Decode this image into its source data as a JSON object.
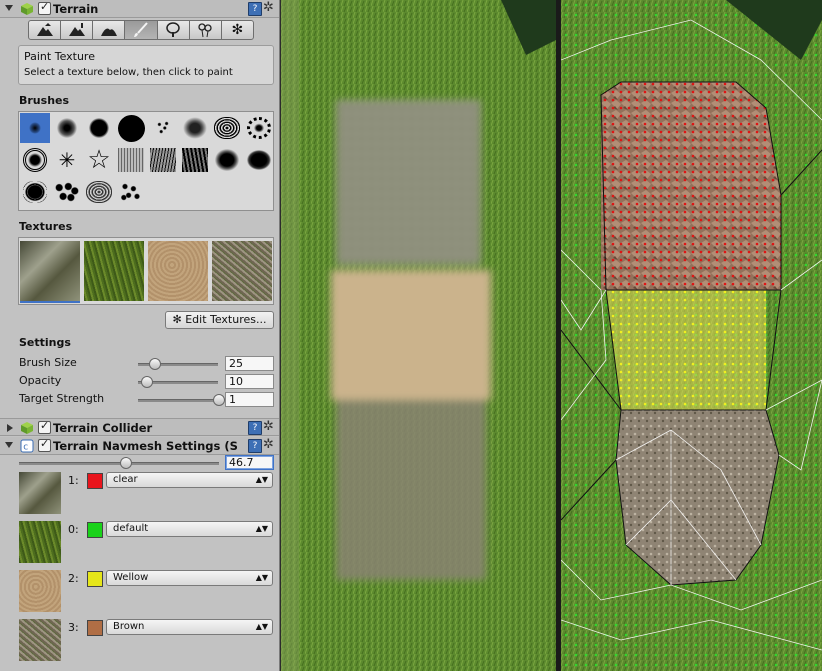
{
  "inspector": {
    "terrain": {
      "title": "Terrain",
      "enabled": true
    },
    "tools": [
      {
        "name": "raise-lower-terrain-tool",
        "icon": "mountain-up-icon"
      },
      {
        "name": "paint-height-tool",
        "icon": "mountain-height-icon"
      },
      {
        "name": "smooth-height-tool",
        "icon": "mountain-smooth-icon"
      },
      {
        "name": "paint-texture-tool",
        "icon": "paintbrush-icon",
        "active": true
      },
      {
        "name": "place-trees-tool",
        "icon": "tree-icon"
      },
      {
        "name": "paint-details-tool",
        "icon": "flowers-icon"
      },
      {
        "name": "terrain-settings-tool",
        "icon": "gear-icon"
      }
    ],
    "info": {
      "title": "Paint Texture",
      "hint": "Select a texture below, then click to paint"
    },
    "brushes_label": "Brushes",
    "textures_label": "Textures",
    "edit_textures_label": "Edit Textures...",
    "settings_label": "Settings",
    "settings": [
      {
        "label": "Brush Size",
        "value": "25",
        "fraction": 0.2
      },
      {
        "label": "Opacity",
        "value": "10",
        "fraction": 0.1
      },
      {
        "label": "Target Strength",
        "value": "1",
        "fraction": 1.0
      }
    ],
    "collider": {
      "title": "Terrain Collider",
      "enabled": true
    },
    "navmesh": {
      "title": "Terrain Navmesh Settings (S",
      "enabled": true,
      "slider_value": "46.7",
      "slider_fraction": 0.53,
      "rows": [
        {
          "index": "1:",
          "color": "#e8141c",
          "option": "clear",
          "texture": "rock"
        },
        {
          "index": "0:",
          "color": "#19d219",
          "option": "default",
          "texture": "grass"
        },
        {
          "index": "2:",
          "color": "#e6e619",
          "option": "Wellow",
          "texture": "sand"
        },
        {
          "index": "3:",
          "color": "#b06e45",
          "option": "Brown",
          "texture": "gravel"
        }
      ]
    }
  },
  "colors": {
    "selection": "#3f72c6",
    "grass": "#5a8a2c",
    "rock": "#6e6e5c",
    "sand": "#c7b08a",
    "gravel": "#8c8274"
  }
}
